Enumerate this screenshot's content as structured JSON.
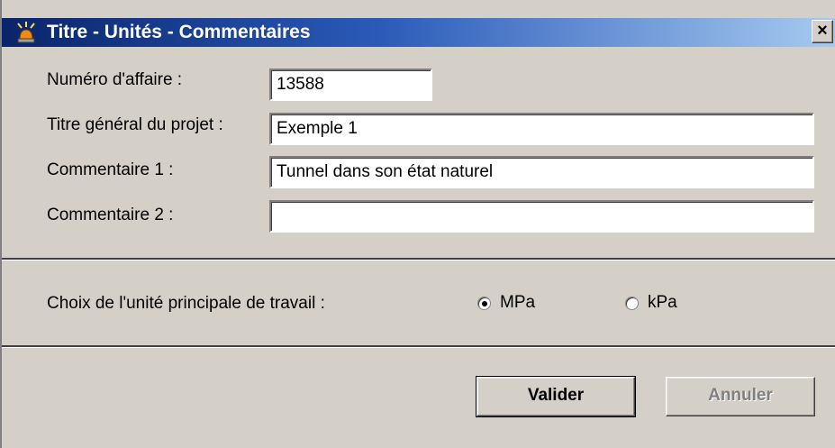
{
  "window": {
    "title": "Titre - Unités - Commentaires",
    "close_label": "×"
  },
  "form": {
    "fields": [
      {
        "label": "Numéro d'affaire :",
        "value": ""
      },
      {
        "label": "Titre général du projet :",
        "value": "Exemple 1"
      },
      {
        "label": "Commentaire 1 :",
        "value": "Tunnel dans son état naturel"
      },
      {
        "label": "Commentaire 2 :",
        "value": ""
      }
    ],
    "numero_value": "13588"
  },
  "units": {
    "label": "Choix de l'unité principale de travail :",
    "options": [
      {
        "label": "MPa",
        "selected": true
      },
      {
        "label": "kPa",
        "selected": false
      }
    ]
  },
  "buttons": {
    "validate": "Valider",
    "cancel": "Annuler",
    "cancel_disabled": true
  },
  "icons": {
    "app": "warning-light-icon"
  }
}
